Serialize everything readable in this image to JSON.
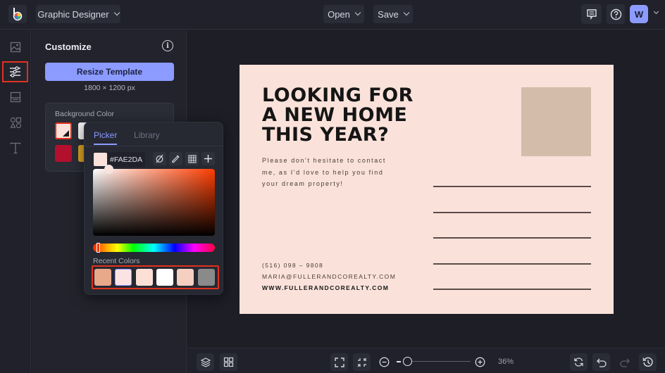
{
  "topbar": {
    "app_logo": "bemyeye-logo",
    "workspace_label": "Graphic Designer",
    "open_label": "Open",
    "save_label": "Save",
    "avatar_initial": "W"
  },
  "icon_rail": {
    "items": [
      {
        "name": "image-icon",
        "active": false
      },
      {
        "name": "sliders-icon",
        "active": true
      },
      {
        "name": "layout-icon",
        "active": false
      },
      {
        "name": "shapes-icon",
        "active": false
      },
      {
        "name": "text-icon",
        "active": false
      }
    ]
  },
  "panel": {
    "title": "Customize",
    "resize_button": "Resize Template",
    "dimensions": "1800 × 1200 px",
    "background_color_label": "Background Color",
    "swatches": [
      "#FAE2DA",
      "#F4F4F4",
      "#B3102E",
      "#D9A021"
    ]
  },
  "color_picker": {
    "tabs": [
      "Picker",
      "Library"
    ],
    "active_tab": "Picker",
    "hex_value": "#FAE2DA",
    "tools": [
      "no-color-icon",
      "eyedropper-icon",
      "grid-icon",
      "plus-icon"
    ],
    "recent_colors_label": "Recent Colors",
    "recent_colors": [
      "#E8A88A",
      "#FBE3E4",
      "#FCE0D6",
      "#FFFFFF",
      "#F5CFC0",
      "#8A8A8A"
    ]
  },
  "postcard": {
    "headline": [
      "LOOKING FOR",
      "A NEW HOME",
      "THIS YEAR?"
    ],
    "body": [
      "Please don't hesitate to contact",
      "me, as I'd love to help you find",
      "your dream property!"
    ],
    "phone": "(516) 098 – 9808",
    "email": "MARIA@FULLERANDCOREALTY.COM",
    "website": "WWW.FULLERANDCOREALTY.COM",
    "background": "#FAE2DA",
    "stamp_color": "#D4BCAA"
  },
  "bottombar": {
    "zoom_percent": "36%",
    "zoom_level": 0.06
  }
}
